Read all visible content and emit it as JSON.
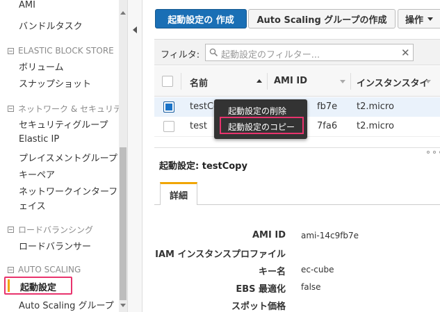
{
  "sidebar": {
    "items": [
      {
        "label": "AMI"
      },
      {
        "label": "バンドルタスク"
      },
      {
        "section": "ELASTIC BLOCK STORE"
      },
      {
        "label": "ボリューム"
      },
      {
        "label": "スナップショット"
      },
      {
        "section": "ネットワーク & セキュリティ"
      },
      {
        "label": "セキュリティグループ"
      },
      {
        "label": "Elastic IP"
      },
      {
        "label": "プレイスメントグループ"
      },
      {
        "label": "キーペア"
      },
      {
        "label": "ネットワークインターフ"
      },
      {
        "label": "ェイス"
      },
      {
        "section": "ロードバランシング"
      },
      {
        "label": "ロードバランサー"
      },
      {
        "section": "AUTO SCALING"
      },
      {
        "label": "起動設定"
      },
      {
        "label": "Auto Scaling グループ"
      }
    ]
  },
  "toolbar": {
    "create_label": "起動設定の 作成",
    "asg_label": "Auto Scaling グループの作成",
    "actions_label": "操作"
  },
  "filter": {
    "label": "フィルタ:",
    "placeholder": "起動設定のフィルター..."
  },
  "table": {
    "headers": [
      "名前",
      "AMI ID",
      "インスタンスタイ"
    ],
    "rows": [
      {
        "name": "testCo",
        "ami": "fb7e",
        "type": "t2.micro",
        "checked": true
      },
      {
        "name": "test",
        "ami": "7fa6",
        "type": "t2.micro",
        "checked": false
      }
    ]
  },
  "context_menu": {
    "items": [
      "起動設定の削除",
      "起動設定のコピー"
    ]
  },
  "detail": {
    "title": "起動設定: testCopy",
    "tab_label": "詳細",
    "fields": [
      {
        "key": "AMI ID",
        "value": "ami-14c9fb7e"
      },
      {
        "key": "IAM インスタンスプロファイル",
        "value": ""
      },
      {
        "key": "キー名",
        "value": "ec-cube"
      },
      {
        "key": "EBS 最適化",
        "value": "false"
      },
      {
        "key": "スポット価格",
        "value": ""
      }
    ]
  },
  "colors": {
    "primary": "#1a6fb5",
    "highlight": "#e8336d",
    "accent": "#f0a500"
  }
}
